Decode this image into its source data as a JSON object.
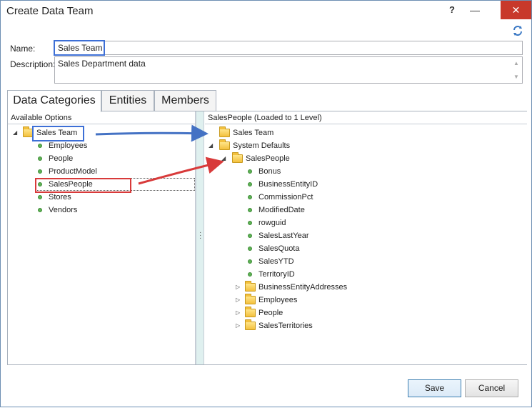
{
  "window": {
    "title": "Create Data Team",
    "help_label": "?",
    "min_label": "—",
    "max_label": "☐",
    "close_label": "✕"
  },
  "form": {
    "name_label": "Name:",
    "name_value": "Sales Team",
    "description_label": "Description:",
    "description_value": "Sales Department data"
  },
  "tabs": [
    {
      "label": "Data Categories",
      "active": true
    },
    {
      "label": "Entities",
      "active": false
    },
    {
      "label": "Members",
      "active": false
    }
  ],
  "left_pane": {
    "header": "Available Options",
    "root": {
      "label": "Sales Team",
      "expanded": true,
      "icon": "folder-open-icon"
    },
    "children": [
      {
        "label": "Employees",
        "icon": "green-dot-icon"
      },
      {
        "label": "People",
        "icon": "green-dot-icon"
      },
      {
        "label": "ProductModel",
        "icon": "green-dot-icon"
      },
      {
        "label": "SalesPeople",
        "icon": "green-dot-icon",
        "selected": true
      },
      {
        "label": "Stores",
        "icon": "green-dot-icon"
      },
      {
        "label": "Vendors",
        "icon": "green-dot-icon"
      }
    ]
  },
  "right_pane": {
    "header": "SalesPeople (Loaded to 1 Level)",
    "nodes": [
      {
        "label": "Sales Team",
        "level": 1,
        "type": "folder",
        "expander": "none"
      },
      {
        "label": "System Defaults",
        "level": 1,
        "type": "folder-open",
        "expander": "expanded"
      },
      {
        "label": "SalesPeople",
        "level": 2,
        "type": "folder-open",
        "expander": "expanded"
      },
      {
        "label": "Bonus",
        "level": 3,
        "type": "field"
      },
      {
        "label": "BusinessEntityID",
        "level": 3,
        "type": "field"
      },
      {
        "label": "CommissionPct",
        "level": 3,
        "type": "field"
      },
      {
        "label": "ModifiedDate",
        "level": 3,
        "type": "field"
      },
      {
        "label": "rowguid",
        "level": 3,
        "type": "field"
      },
      {
        "label": "SalesLastYear",
        "level": 3,
        "type": "field"
      },
      {
        "label": "SalesQuota",
        "level": 3,
        "type": "field"
      },
      {
        "label": "SalesYTD",
        "level": 3,
        "type": "field"
      },
      {
        "label": "TerritoryID",
        "level": 3,
        "type": "field"
      },
      {
        "label": "BusinessEntityAddresses",
        "level": 3,
        "type": "folder",
        "expander": "collapsed"
      },
      {
        "label": "Employees",
        "level": 3,
        "type": "folder",
        "expander": "collapsed"
      },
      {
        "label": "People",
        "level": 3,
        "type": "folder",
        "expander": "collapsed"
      },
      {
        "label": "SalesTerritories",
        "level": 3,
        "type": "folder",
        "expander": "collapsed"
      }
    ]
  },
  "buttons": {
    "save": "Save",
    "cancel": "Cancel"
  },
  "colors": {
    "highlight_blue": "#3d6fd6",
    "highlight_red": "#d83a3a",
    "close_button": "#c8392b"
  }
}
